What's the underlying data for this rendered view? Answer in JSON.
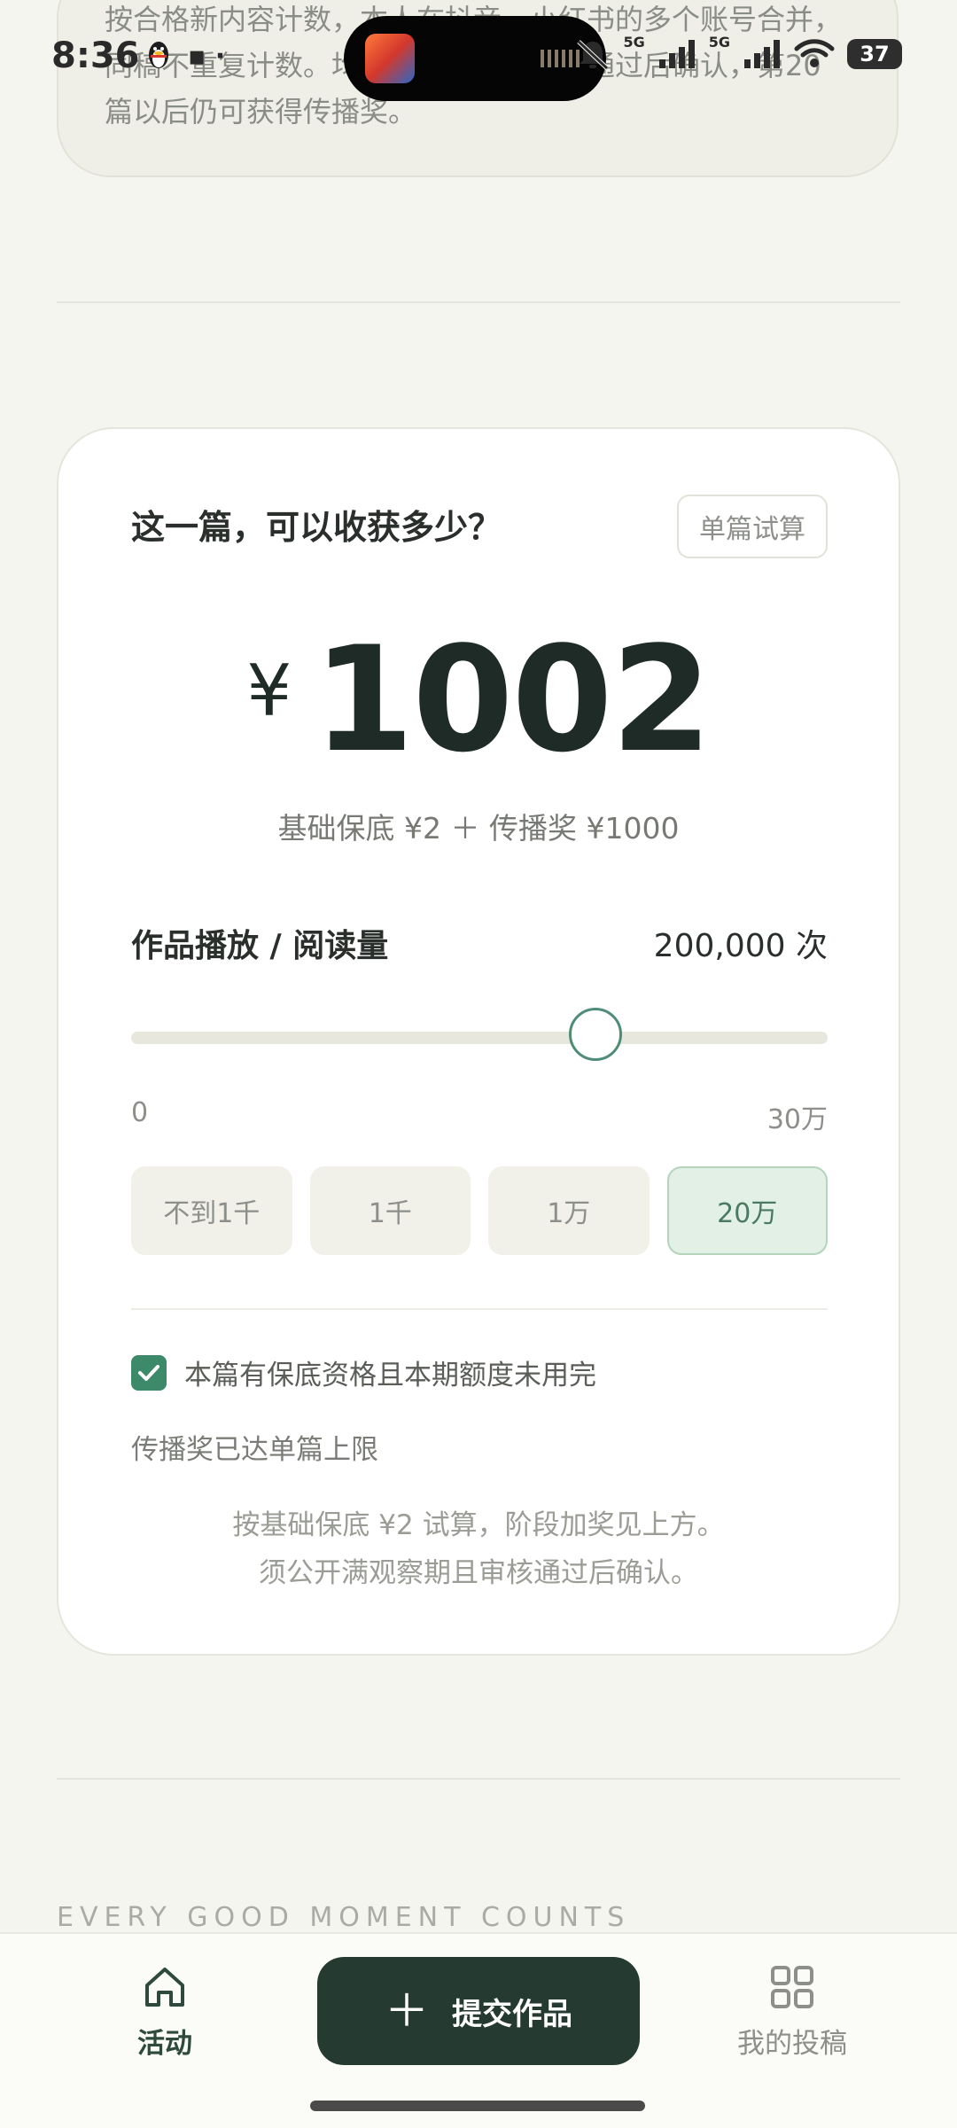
{
  "status_bar": {
    "time": "8:36",
    "network_1": "5G",
    "network_2": "5G",
    "battery": "37"
  },
  "previous_card": {
    "text": "按合格新内容计数，本人在抖音、小红书的多个账号合并，\n同稿不重复计数。均须满观察期且审核通过后确认，第20\n篇以后仍可获得传播奖。"
  },
  "calculator": {
    "title": "这一篇，可以收获多少？",
    "calc_button": "单篇试算",
    "currency_symbol": "¥",
    "amount": "1002",
    "breakdown": "基础保底 ¥2 ＋ 传播奖 ¥1000",
    "metric_label": "作品播放 / 阅读量",
    "metric_value": "200,000 次",
    "slider": {
      "range_min": "0",
      "range_max": "30万",
      "current_fraction": 0.6667
    },
    "presets": [
      {
        "label": "不到1千",
        "active": false
      },
      {
        "label": "1千",
        "active": false
      },
      {
        "label": "1万",
        "active": false
      },
      {
        "label": "20万",
        "active": true
      }
    ],
    "checkbox": {
      "checked": true,
      "label": "本篇有保底资格且本期额度未用完"
    },
    "limit_note": "传播奖已达单篇上限",
    "foot_note": "按基础保底 ¥2 试算，阶段加奖见上方。\n须公开满观察期且审核通过后确认。"
  },
  "tagline": "EVERY GOOD MOMENT COUNTS",
  "tabbar": {
    "activity_label": "活动",
    "submit_label": "提交作品",
    "mine_label": "我的投稿"
  },
  "colors": {
    "accent_dark": "#253a30",
    "accent_green": "#3d8a6a",
    "background": "#f5f5f0",
    "preset_active_bg": "#e3f0e5"
  },
  "icons": {
    "activity": "home-icon",
    "submit": "plus-icon",
    "mine": "grid-icon",
    "checkbox": "check-icon"
  }
}
